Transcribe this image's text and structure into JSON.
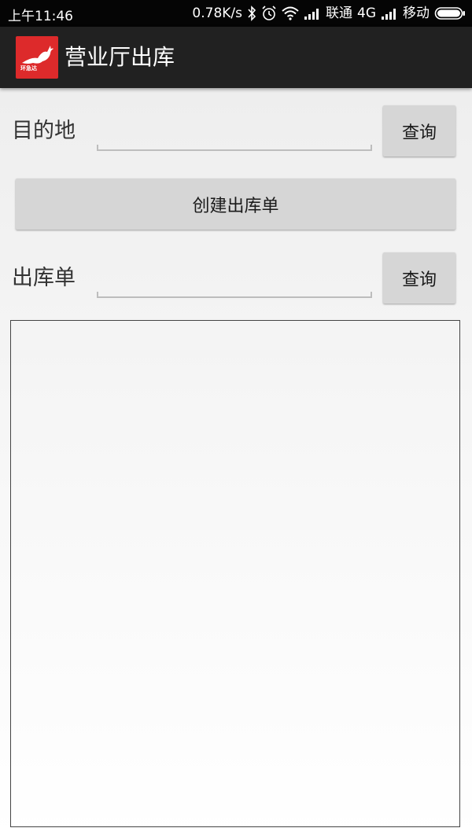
{
  "status_bar": {
    "time": "上午11:46",
    "net_speed": "0.78K/s",
    "carrier1": "联通",
    "network_type": "4G",
    "carrier2": "移动",
    "icons": [
      "bluetooth-icon",
      "alarm-icon",
      "wifi-icon",
      "signal-icon",
      "signal-icon",
      "battery-icon"
    ]
  },
  "action_bar": {
    "title": "营业厅出库",
    "logo_text": "环急达",
    "logo_color": "#dd2a2b"
  },
  "form": {
    "destination_label": "目的地",
    "destination_value": "",
    "destination_query_label": "查询",
    "create_button_label": "创建出库单",
    "order_label": "出库单",
    "order_value": "",
    "order_query_label": "查询"
  },
  "order_list": {
    "items": []
  }
}
